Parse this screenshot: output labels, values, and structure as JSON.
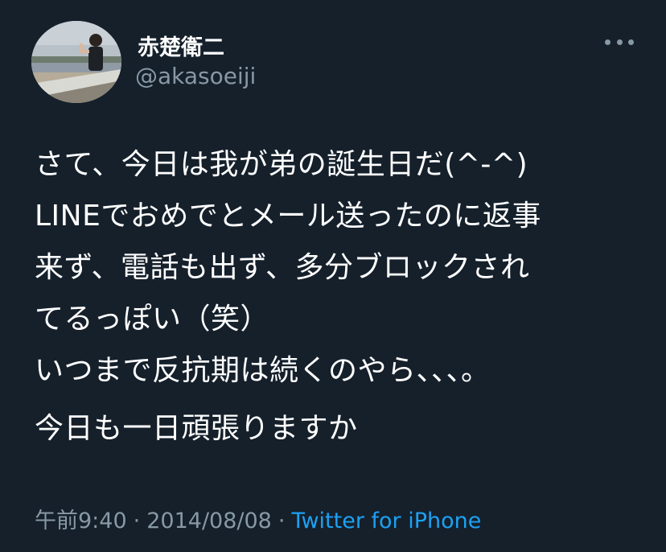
{
  "author": {
    "display_name": "赤楚衛二",
    "handle": "@akasoeiji"
  },
  "more_icon": "more-horizontal-icon",
  "tweet": {
    "lines": [
      "さて、今日は我が弟の誕生日だ(^-^)",
      "LINEでおめでとメール送ったのに返事",
      "来ず、電話も出ず、多分ブロックされ",
      "てるっぽい（笑）",
      "いつまで反抗期は続くのやら、、、。",
      "今日も一日頑張りますか"
    ]
  },
  "meta": {
    "time": "午前9:40",
    "separator": "·",
    "date": "2014/08/08",
    "source": "Twitter for iPhone"
  },
  "colors": {
    "background": "#15202b",
    "text": "#ffffff",
    "secondary": "#8899a6",
    "link": "#1da1f2"
  }
}
